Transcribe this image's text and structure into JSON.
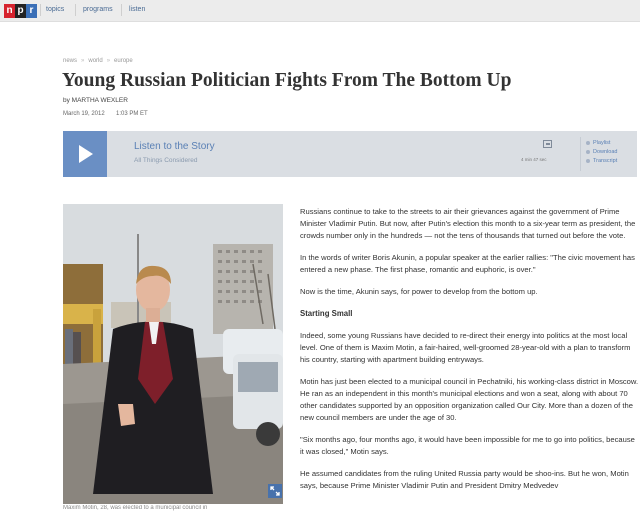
{
  "nav": {
    "logo": [
      "n",
      "p",
      "r"
    ],
    "links": [
      "topics",
      "programs",
      "listen"
    ]
  },
  "breadcrumb": [
    "news",
    "world",
    "europe"
  ],
  "article": {
    "title": "Young Russian Politician Fights From The Bottom Up",
    "byline": "by MARTHA WEXLER",
    "date": "March 19, 2012",
    "time": "1:03 PM ET"
  },
  "player": {
    "listen_label": "Listen to the Story",
    "program": "All Things Considered",
    "duration": "4 min 47 sec",
    "links": [
      "Playlist",
      "Download",
      "Transcript"
    ]
  },
  "photo": {
    "caption": "Maxim Motin, 28, was elected to a municipal council in"
  },
  "body": {
    "p1": "Russians continue to take to the streets to air their grievances against the government of Prime Minister Vladimir Putin. But now, after Putin's election this month to a six-year term as president, the crowds number only in the hundreds — not the tens of thousands that turned out before the vote.",
    "p2": "In the words of writer Boris Akunin, a popular speaker at the earlier rallies: \"The civic movement has entered a new phase. The first phase, romantic and euphoric, is over.\"",
    "p3": "Now is the time, Akunin says, for power to develop from the bottom up.",
    "heading": "Starting Small",
    "p4": "Indeed, some young Russians have decided to re-direct their energy into politics at the most local level. One of them is Maxim Motin, a fair-haired, well-groomed 28-year-old with a plan to transform his country, starting with apartment building entryways.",
    "p5": "Motin has just been elected to a municipal council in Pechatniki, his working-class district in Moscow. He ran as an independent in this month's municipal elections and won a seat, along with about 70 other candidates supported by an opposition organization called Our City. More than a dozen of the new council members are under the age of 30.",
    "p6": "\"Six months ago, four months ago, it would have been impossible for me to go into politics, because it was closed,\" Motin says.",
    "p7": "He assumed candidates from the ruling United Russia party would be shoo-ins. But he won, Motin says, because Prime Minister Vladimir Putin and President Dmitry Medvedev"
  },
  "colors": {
    "npr_red": "#d6232e",
    "npr_black": "#222222",
    "npr_blue": "#3a6fb7",
    "play_button": "#6a8fc4",
    "link_blue": "#5a80b5"
  },
  "icons": [
    "play-icon",
    "embed-icon",
    "expand-icon",
    "bullet-icon"
  ]
}
